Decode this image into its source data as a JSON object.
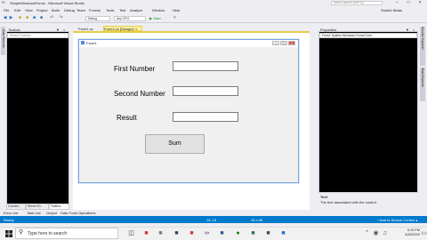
{
  "window": {
    "title": "SimpleWindowsForms - Microsoft Visual Studio",
    "quick_launch_placeholder": "Quick Launch (Ctrl+Q)",
    "user": "Shahid Ilkhan"
  },
  "menu": [
    "File",
    "Edit",
    "View",
    "Project",
    "Build",
    "Debug",
    "Team",
    "Format",
    "Tools",
    "Test",
    "Analyze",
    "Window",
    "Help"
  ],
  "toolbar": {
    "config": "Debug",
    "platform": "Any CPU",
    "start_label": "▶ Start"
  },
  "left_tab": {
    "label": "Data Sources"
  },
  "toolbox": {
    "title": "Toolbox",
    "search_placeholder": "Search Toolbox",
    "bottom_tabs": [
      "Coordin...",
      "Server Ex...",
      "Toolbox"
    ]
  },
  "doc_tabs": [
    {
      "label": "Form1.cs"
    },
    {
      "label": "Form1.cs [Design]*"
    }
  ],
  "form": {
    "caption": "Form1",
    "labels": {
      "first": "First Number",
      "second": "Second Number",
      "result": "Result"
    },
    "sum_button": "Sum"
  },
  "properties": {
    "title": "Properties",
    "object": "Form1  System.Windows.Forms.Form",
    "desc_title": "Text",
    "desc_text": "The text associated with the control."
  },
  "right_tabs": [
    "Solution Explorer",
    "Team Explorer"
  ],
  "output_tabs": [
    "Error List",
    "Task List",
    "Output",
    "Data Tools Operations"
  ],
  "status": {
    "left": "Ready",
    "position": "15, 15",
    "size": "15 x 65",
    "right": "↑ Add to Source Control ▴"
  },
  "taskbar": {
    "search_placeholder": "Type here to search",
    "time": "9:19 PM",
    "date": "4/26/2020"
  }
}
